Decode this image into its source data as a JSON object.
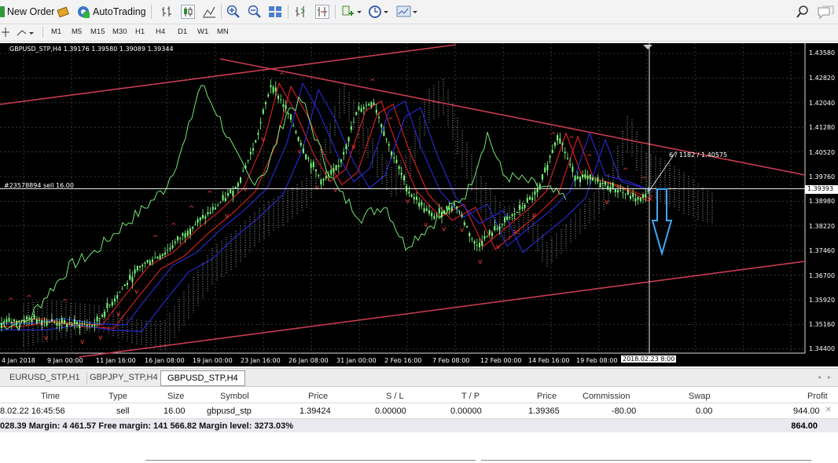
{
  "toolbar": {
    "new_order": "New Order",
    "auto_trading": "AutoTrading",
    "timeframes": [
      "M1",
      "M5",
      "M15",
      "M30",
      "H1",
      "H4",
      "D1",
      "W1",
      "MN"
    ],
    "active_timeframe": "H4"
  },
  "chart": {
    "title": "GBPUSD_STP,H4  1.39176 1.39580 1.39089 1.39344",
    "order_label": "#23578894 sell 16.00",
    "fib_label": "6 / 1182 / 1.40575",
    "current_price": "1.39393",
    "crosshair_date": "2018.02.23 8:00",
    "price_labels": [
      "1.43580",
      "1.42820",
      "1.42040",
      "1.41280",
      "1.40520",
      "1.39760",
      "1.38980",
      "1.38220",
      "1.37460",
      "1.36700",
      "1.35920",
      "1.35160",
      "1.34400"
    ],
    "date_labels": [
      "4 Jan 2018",
      "9 Jan 00:00",
      "11 Jan 16:00",
      "16 Jan 08:00",
      "19 Jan 00:00",
      "23 Jan 16:00",
      "26 Jan 08:00",
      "31 Jan 00:00",
      "2 Feb 16:00",
      "7 Feb 08:00",
      "12 Feb 00:00",
      "14 Feb 16:00",
      "19 Feb 08:00"
    ],
    "colors": {
      "background": "#000000",
      "candle": "#7CFC7C",
      "ma_red": "#e02020",
      "ma_blue": "#2a2ad8",
      "cloud": "#d8d8d8",
      "trendline": "#c83c50",
      "arrow": "#3fa9f5"
    }
  },
  "chart_tabs": [
    {
      "label": "EURUSD_STP,H1",
      "active": false
    },
    {
      "label": "GBPJPY_STP,H4",
      "active": false
    },
    {
      "label": "GBPUSD_STP,H4",
      "active": true
    }
  ],
  "trade_table": {
    "headers": [
      "Time",
      "Type",
      "Size",
      "Symbol",
      "Price",
      "S / L",
      "T / P",
      "Price",
      "Commission",
      "Swap",
      "Profit"
    ],
    "row": [
      "8.02.22 16:45:56",
      "sell",
      "16.00",
      "gbpusd_stp",
      "1.39424",
      "0.00000",
      "0.00000",
      "1.39365",
      "-80.00",
      "0.00",
      "944.00"
    ],
    "summary": "028.39  Margin: 4 461.57  Free margin: 141 566.82  Margin level: 3273.03%",
    "summary_profit": "864.00"
  }
}
